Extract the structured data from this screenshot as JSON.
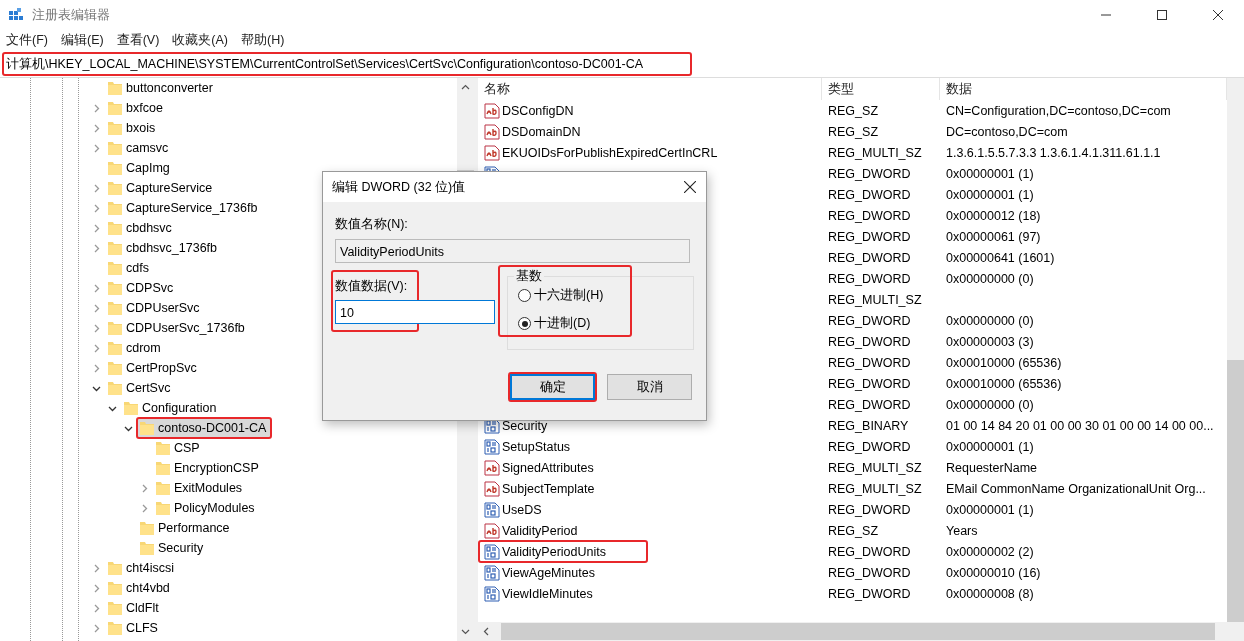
{
  "window": {
    "title": "注册表编辑器"
  },
  "menu": [
    "文件(F)",
    "编辑(E)",
    "查看(V)",
    "收藏夹(A)",
    "帮助(H)"
  ],
  "address_bar": {
    "value": "计算机\\HKEY_LOCAL_MACHINE\\SYSTEM\\CurrentControlSet\\Services\\CertSvc\\Configuration\\contoso-DC001-CA",
    "annotated": true
  },
  "tree": [
    {
      "label": "buttonconverter",
      "has_children": false,
      "selected": false,
      "annotated": false
    },
    {
      "label": "bxfcoe",
      "has_children": true,
      "expanded": false,
      "selected": false,
      "annotated": false
    },
    {
      "label": "bxois",
      "has_children": true,
      "expanded": false,
      "selected": false,
      "annotated": false
    },
    {
      "label": "camsvc",
      "has_children": true,
      "expanded": false,
      "selected": false,
      "annotated": false
    },
    {
      "label": "CapImg",
      "has_children": false,
      "selected": false,
      "annotated": false
    },
    {
      "label": "CaptureService",
      "has_children": true,
      "expanded": false,
      "selected": false,
      "annotated": false
    },
    {
      "label": "CaptureService_1736fb",
      "has_children": true,
      "expanded": false,
      "selected": false,
      "annotated": false
    },
    {
      "label": "cbdhsvc",
      "has_children": true,
      "expanded": false,
      "selected": false,
      "annotated": false
    },
    {
      "label": "cbdhsvc_1736fb",
      "has_children": true,
      "expanded": false,
      "selected": false,
      "annotated": false
    },
    {
      "label": "cdfs",
      "has_children": false,
      "selected": false,
      "annotated": false
    },
    {
      "label": "CDPSvc",
      "has_children": true,
      "expanded": false,
      "selected": false,
      "annotated": false
    },
    {
      "label": "CDPUserSvc",
      "has_children": true,
      "expanded": false,
      "selected": false,
      "annotated": false
    },
    {
      "label": "CDPUserSvc_1736fb",
      "has_children": true,
      "expanded": false,
      "selected": false,
      "annotated": false
    },
    {
      "label": "cdrom",
      "has_children": true,
      "expanded": false,
      "selected": false,
      "annotated": false
    },
    {
      "label": "CertPropSvc",
      "has_children": true,
      "expanded": false,
      "selected": false,
      "annotated": false
    },
    {
      "label": "CertSvc",
      "has_children": true,
      "expanded": true,
      "selected": false,
      "annotated": false,
      "children": [
        {
          "label": "Configuration",
          "has_children": true,
          "expanded": true,
          "selected": false,
          "annotated": false,
          "children": [
            {
              "label": "contoso-DC001-CA",
              "has_children": true,
              "expanded": true,
              "selected": true,
              "annotated": true,
              "children": [
                {
                  "label": "CSP",
                  "has_children": false,
                  "selected": false,
                  "annotated": false
                },
                {
                  "label": "EncryptionCSP",
                  "has_children": false,
                  "selected": false,
                  "annotated": false
                },
                {
                  "label": "ExitModules",
                  "has_children": true,
                  "expanded": false,
                  "selected": false,
                  "annotated": false
                },
                {
                  "label": "PolicyModules",
                  "has_children": true,
                  "expanded": false,
                  "selected": false,
                  "annotated": false
                }
              ]
            },
            {
              "label": "Performance",
              "has_children": false,
              "selected": false,
              "annotated": false
            },
            {
              "label": "Security",
              "has_children": false,
              "selected": false,
              "annotated": false
            }
          ]
        }
      ]
    },
    {
      "label": "cht4iscsi",
      "has_children": true,
      "expanded": false,
      "selected": false,
      "annotated": false
    },
    {
      "label": "cht4vbd",
      "has_children": true,
      "expanded": false,
      "selected": false,
      "annotated": false
    },
    {
      "label": "CldFlt",
      "has_children": true,
      "expanded": false,
      "selected": false,
      "annotated": false
    },
    {
      "label": "CLFS",
      "has_children": true,
      "expanded": false,
      "selected": false,
      "annotated": false
    }
  ],
  "values": {
    "columns": [
      "名称",
      "类型",
      "数据"
    ],
    "rows": [
      {
        "kind": "string",
        "name": "DSConfigDN",
        "type": "REG_SZ",
        "data": "CN=Configuration,DC=contoso,DC=com",
        "annotated": false
      },
      {
        "kind": "string",
        "name": "DSDomainDN",
        "type": "REG_SZ",
        "data": "DC=contoso,DC=com",
        "annotated": false
      },
      {
        "kind": "string",
        "name": "EKUOIDsForPublishExpiredCertInCRL",
        "type": "REG_MULTI_SZ",
        "data": "1.3.6.1.5.5.7.3.3 1.3.6.1.4.1.311.61.1.1",
        "annotated": false
      },
      {
        "kind": "binary",
        "type": "REG_DWORD",
        "data": "0x00000001 (1)"
      },
      {
        "type": "REG_DWORD",
        "data": "0x00000001 (1)"
      },
      {
        "type": "REG_DWORD",
        "data": "0x00000012 (18)"
      },
      {
        "type": "REG_DWORD",
        "data": "0x00000061 (97)"
      },
      {
        "type": "REG_DWORD",
        "data": "0x00000641 (1601)"
      },
      {
        "type": "REG_DWORD",
        "data": "0x00000000 (0)"
      },
      {
        "type": "REG_MULTI_SZ"
      },
      {
        "type": "REG_DWORD",
        "data": "0x00000000 (0)"
      },
      {
        "type": "REG_DWORD",
        "data": "0x00000003 (3)"
      },
      {
        "type": "REG_DWORD",
        "data": "0x00010000 (65536)"
      },
      {
        "type": "REG_DWORD",
        "data": "0x00010000 (65536)"
      },
      {
        "type": "REG_DWORD",
        "data": "0x00000000 (0)"
      },
      {
        "kind": "binary",
        "name": "Security",
        "type": "REG_BINARY",
        "data": "01 00 14 84 20 01 00 00 30 01 00 00 14 00 00...",
        "annotated": false
      },
      {
        "kind": "binary",
        "name": "SetupStatus",
        "type": "REG_DWORD",
        "data": "0x00000001 (1)",
        "annotated": false
      },
      {
        "kind": "string",
        "name": "SignedAttributes",
        "type": "REG_MULTI_SZ",
        "data": "RequesterName",
        "annotated": false
      },
      {
        "kind": "string",
        "name": "SubjectTemplate",
        "type": "REG_MULTI_SZ",
        "data": "EMail CommonName OrganizationalUnit Org...",
        "annotated": false
      },
      {
        "kind": "binary",
        "name": "UseDS",
        "type": "REG_DWORD",
        "data": "0x00000001 (1)",
        "annotated": false
      },
      {
        "kind": "string",
        "name": "ValidityPeriod",
        "type": "REG_SZ",
        "data": "Years",
        "annotated": false
      },
      {
        "kind": "binary",
        "name": "ValidityPeriodUnits",
        "type": "REG_DWORD",
        "data": "0x00000002 (2)",
        "annotated": true
      },
      {
        "kind": "binary",
        "name": "ViewAgeMinutes",
        "type": "REG_DWORD",
        "data": "0x00000010 (16)",
        "annotated": false
      },
      {
        "kind": "binary",
        "name": "ViewIdleMinutes",
        "type": "REG_DWORD",
        "data": "0x00000008 (8)",
        "annotated": false
      }
    ]
  },
  "dialog": {
    "title": "编辑 DWORD (32 位)值",
    "name_label": "数值名称(N):",
    "name_value": "ValidityPeriodUnits",
    "data_label": "数值数据(V):",
    "data_value": "10",
    "data_annotated": true,
    "base": {
      "label": "基数",
      "annotated": true,
      "options": [
        {
          "label": "十六进制(H)",
          "selected": false
        },
        {
          "label": "十进制(D)",
          "selected": true
        }
      ]
    },
    "buttons": [
      {
        "label": "确定",
        "default": true,
        "annotated": true
      },
      {
        "label": "取消",
        "default": false,
        "annotated": false
      }
    ]
  }
}
